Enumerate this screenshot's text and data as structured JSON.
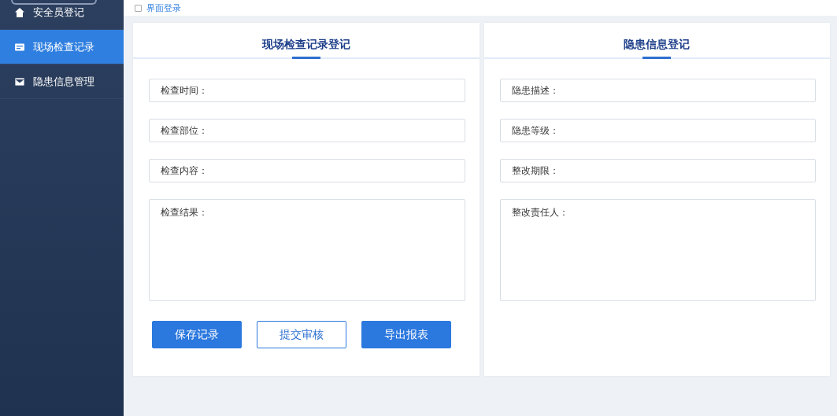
{
  "sidebar": {
    "items": [
      {
        "label": "安全员登记",
        "selected": false
      },
      {
        "label": "现场检查记录",
        "selected": true
      },
      {
        "label": "隐患信息管理",
        "selected": false
      }
    ]
  },
  "top_bar": {
    "checked": false,
    "link": "界面登录"
  },
  "panels": [
    {
      "title": "现场检查记录登记",
      "fields": [
        {
          "label": "检查时间：",
          "kind": "line"
        },
        {
          "label": "检查部位：",
          "kind": "line"
        },
        {
          "label": "检查内容：",
          "kind": "line"
        },
        {
          "label": "检查结果：",
          "kind": "area"
        }
      ],
      "buttons": [
        {
          "label": "保存记录",
          "kind": "primary"
        },
        {
          "label": "提交审核",
          "kind": "outline"
        },
        {
          "label": "导出报表",
          "kind": "primary"
        }
      ]
    },
    {
      "title": "隐患信息登记",
      "fields": [
        {
          "label": "隐患描述：",
          "kind": "line"
        },
        {
          "label": "隐患等级：",
          "kind": "line"
        },
        {
          "label": "整改期限：",
          "kind": "line"
        },
        {
          "label": "整改责任人：",
          "kind": "area"
        }
      ]
    }
  ]
}
